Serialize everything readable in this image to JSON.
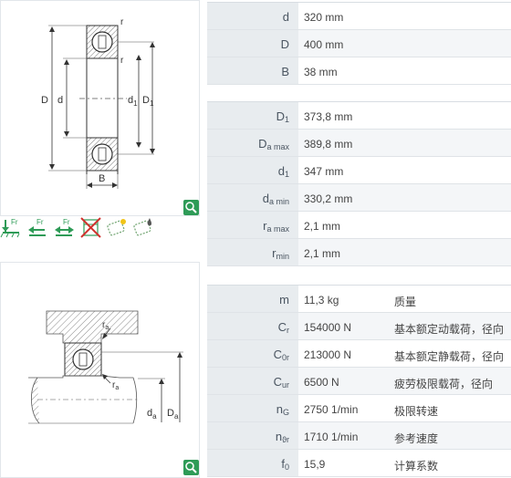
{
  "drawing1": {
    "labels": {
      "r_top": "r",
      "r_mid": "r",
      "D": "D",
      "d": "d",
      "d1": "d",
      "d1_sub": "1",
      "D1": "D",
      "D1_sub": "1",
      "B": "B"
    }
  },
  "drawing2": {
    "labels": {
      "ra_top": "r",
      "ra_top_sub": "a",
      "ra_bot": "r",
      "ra_bot_sub": "a",
      "da": "d",
      "da_sub": "a",
      "Da": "D",
      "Da_sub": "a"
    }
  },
  "icons": [
    {
      "name": "fixed-bearing-icon",
      "text": "Fr"
    },
    {
      "name": "radial-load-left-icon",
      "text": "Fr"
    },
    {
      "name": "radial-load-both-icon",
      "text": "Fr"
    },
    {
      "name": "not-suitable-icon",
      "text": ""
    },
    {
      "name": "sealed-lubricated-icon",
      "text": ""
    },
    {
      "name": "oil-lubrication-icon",
      "text": ""
    }
  ],
  "dimensions": [
    {
      "label": "d",
      "sub": "",
      "value": "320  mm"
    },
    {
      "label": "D",
      "sub": "",
      "value": "400  mm"
    },
    {
      "label": "B",
      "sub": "",
      "value": "38  mm"
    }
  ],
  "abutments": [
    {
      "label": "D",
      "sub": "1",
      "value": "373,8  mm"
    },
    {
      "label": "D",
      "sub": "a max",
      "value": "389,8  mm"
    },
    {
      "label": "d",
      "sub": "1",
      "value": "347  mm"
    },
    {
      "label": "d",
      "sub": "a min",
      "value": "330,2  mm"
    },
    {
      "label": "r",
      "sub": "a max",
      "value": "2,1  mm"
    },
    {
      "label": "r",
      "sub": "min",
      "value": "2,1  mm"
    }
  ],
  "properties": [
    {
      "label": "m",
      "sub": "",
      "value": "11,3  kg",
      "desc": "质量"
    },
    {
      "label": "C",
      "sub": "r",
      "value": "154000  N",
      "desc": "基本额定动载荷，径向"
    },
    {
      "label": "C",
      "sub": "0r",
      "value": "213000  N",
      "desc": "基本额定静载荷，径向"
    },
    {
      "label": "C",
      "sub": "ur",
      "value": "6500  N",
      "desc": "疲劳极限载荷，径向"
    },
    {
      "label": "n",
      "sub": "G",
      "value": "2750  1/min",
      "desc": "极限转速"
    },
    {
      "label": "n",
      "sub": "ϑr",
      "value": "1710  1/min",
      "desc": "参考速度"
    },
    {
      "label": "f",
      "sub": "0",
      "value": "15,9",
      "desc": "计算系数"
    }
  ],
  "colors": {
    "accent_green": "#2e9b57",
    "label_bg": "#e8ecef",
    "row_alt": "#f4f6f8"
  }
}
